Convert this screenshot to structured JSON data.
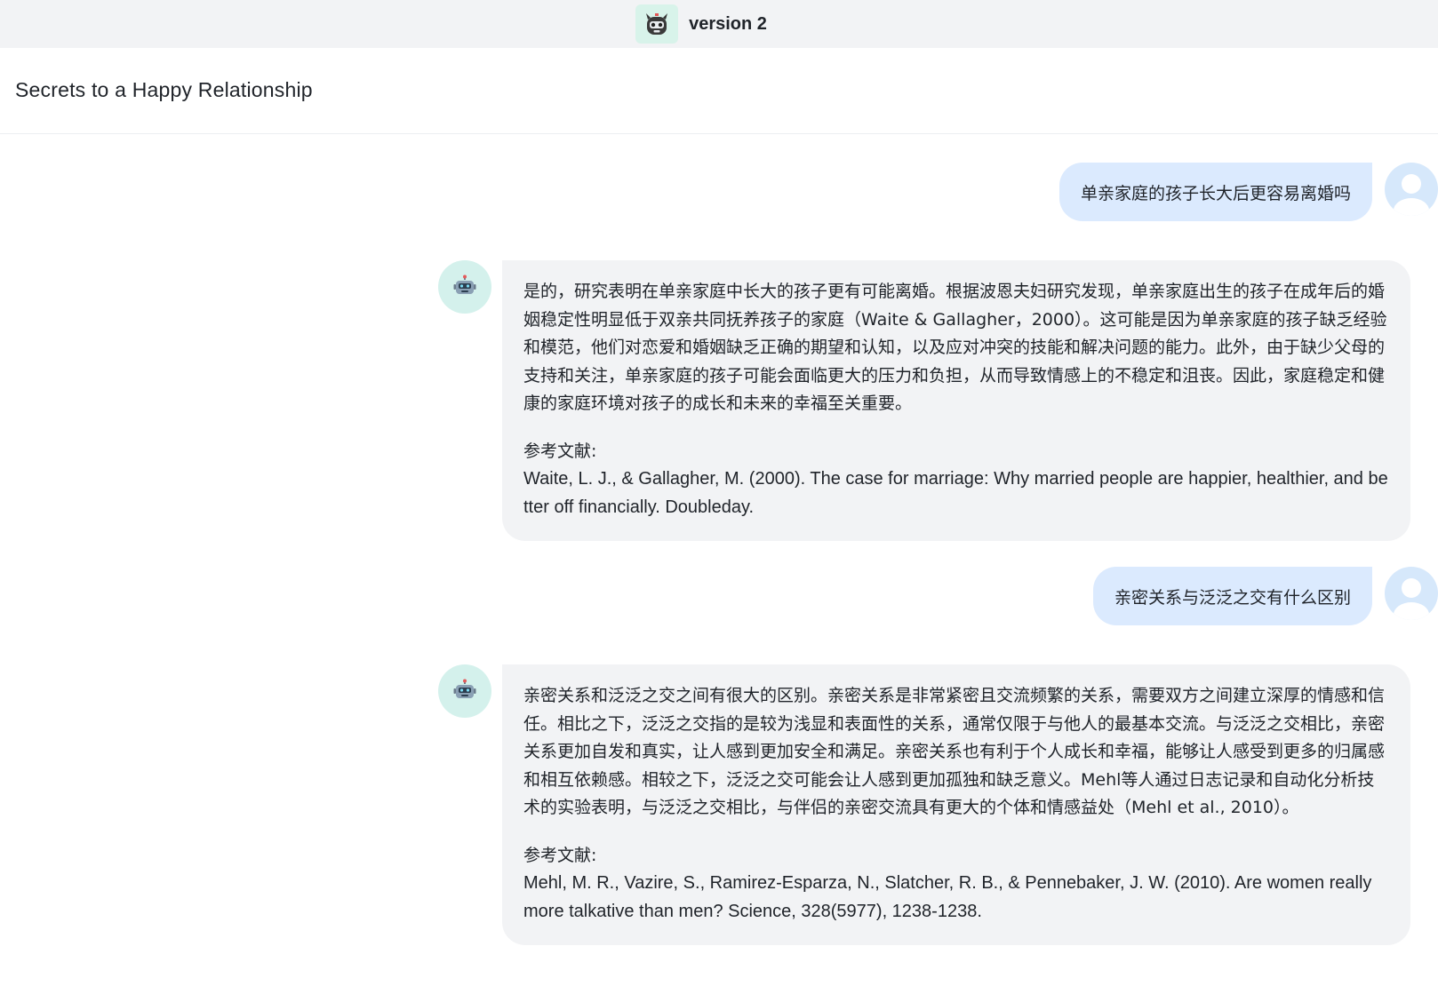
{
  "app": {
    "title": "version 2",
    "logo_icon": "robot-face-icon"
  },
  "conversation": {
    "title": "Secrets to a Happy Relationship"
  },
  "colors": {
    "topbar_bg": "#f2f3f5",
    "user_bubble": "#dbeafe",
    "bot_bubble": "#f2f3f5",
    "bot_avatar_bg": "#d4f1ec",
    "user_avatar_bg": "#d6e8fb"
  },
  "messages": [
    {
      "role": "user",
      "text": "单亲家庭的孩子长大后更容易离婚吗",
      "avatar_icon": "user-avatar-icon"
    },
    {
      "role": "assistant",
      "avatar_icon": "robot-avatar-icon",
      "body": "是的，研究表明在单亲家庭中长大的孩子更有可能离婚。根据波恩夫妇研究发现，单亲家庭出生的孩子在成年后的婚姻稳定性明显低于双亲共同抚养孩子的家庭（Waite & Gallagher，2000）。这可能是因为单亲家庭的孩子缺乏经验和模范，他们对恋爱和婚姻缺乏正确的期望和认知，以及应对冲突的技能和解决问题的能力。此外，由于缺少父母的支持和关注，单亲家庭的孩子可能会面临更大的压力和负担，从而导致情感上的不稳定和沮丧。因此，家庭稳定和健康的家庭环境对孩子的成长和未来的幸福至关重要。",
      "ref_title": "参考文献:",
      "ref_text": "Waite, L. J., & Gallagher, M. (2000). The case for marriage: Why married people are happier, healthier, and better off financially. Doubleday."
    },
    {
      "role": "user",
      "text": "亲密关系与泛泛之交有什么区别",
      "avatar_icon": "user-avatar-icon"
    },
    {
      "role": "assistant",
      "avatar_icon": "robot-avatar-icon",
      "body": "亲密关系和泛泛之交之间有很大的区别。亲密关系是非常紧密且交流频繁的关系，需要双方之间建立深厚的情感和信任。相比之下，泛泛之交指的是较为浅显和表面性的关系，通常仅限于与他人的最基本交流。与泛泛之交相比，亲密关系更加自发和真实，让人感到更加安全和满足。亲密关系也有利于个人成长和幸福，能够让人感受到更多的归属感和相互依赖感。相较之下，泛泛之交可能会让人感到更加孤独和缺乏意义。Mehl等人通过日志记录和自动化分析技术的实验表明，与泛泛之交相比，与伴侣的亲密交流具有更大的个体和情感益处（Mehl et al., 2010）。",
      "ref_title": "参考文献:",
      "ref_text": "Mehl, M. R., Vazire, S., Ramirez-Esparza, N., Slatcher, R. B., & Pennebaker, J. W. (2010). Are women really more talkative than men? Science, 328(5977), 1238-1238."
    }
  ]
}
